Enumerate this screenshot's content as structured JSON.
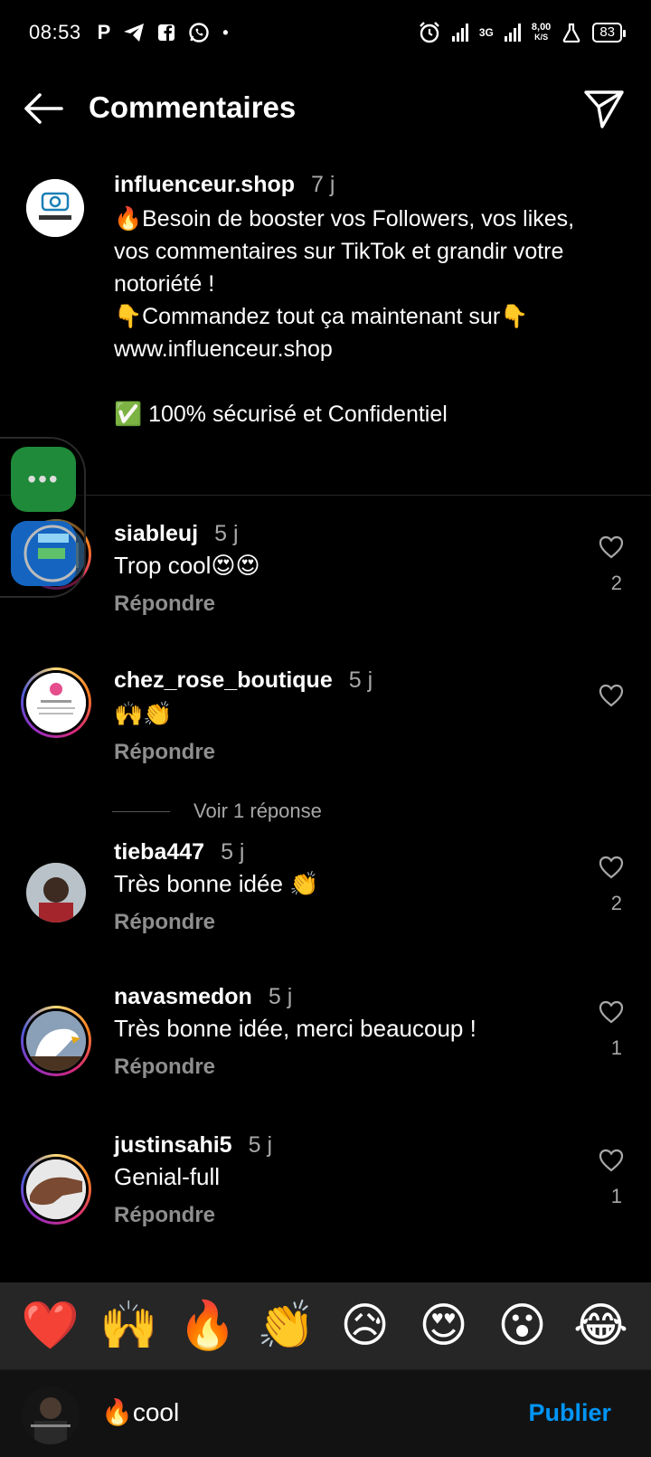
{
  "status_bar": {
    "time": "08:53",
    "left_icons": [
      "P",
      "telegram-icon",
      "facebook-icon",
      "whatsapp-icon",
      "•"
    ],
    "network_label": "3G",
    "net_speed": "8,00",
    "net_speed_unit": "K/S",
    "battery": "83"
  },
  "header": {
    "title": "Commentaires"
  },
  "caption": {
    "username": "influenceur.shop",
    "time": "7 j",
    "text": "🔥Besoin de booster vos Followers, vos likes, vos commentaires sur TikTok et grandir votre notoriété !\n👇Commandez tout ça maintenant sur👇\n www.influenceur.shop\n\n✅ 100% sécurisé et Confidentiel"
  },
  "comments": [
    {
      "username": "siableuj",
      "time": "5 j",
      "text": "Trop cool😍😍",
      "reply": "Répondre",
      "likes": "2"
    },
    {
      "username": "chez_rose_boutique",
      "time": "5 j",
      "text": "🙌👏",
      "reply": "Répondre",
      "likes": ""
    },
    {
      "username": "tieba447",
      "time": "5 j",
      "text": "Très bonne idée 👏",
      "reply": "Répondre",
      "likes": "2"
    },
    {
      "username": "navasmedon",
      "time": "5 j",
      "text": "Très bonne idée, merci beaucoup !",
      "reply": "Répondre",
      "likes": "1"
    },
    {
      "username": "justinsahi5",
      "time": "5 j",
      "text": "Genial-full",
      "reply": "Répondre",
      "likes": "1"
    }
  ],
  "view_replies": "Voir 1 réponse",
  "floating_bubble": {
    "dots": "•••"
  },
  "reactions": [
    "❤️",
    "🙌",
    "🔥",
    "👏",
    "😥",
    "😍",
    "😮",
    "😂"
  ],
  "composer": {
    "value": "🔥cool",
    "publish_label": "Publier"
  },
  "colors": {
    "background": "#000000",
    "link_blue": "#0095f6",
    "secondary_text": "#8e8e8e",
    "reaction_bar": "#262626"
  }
}
